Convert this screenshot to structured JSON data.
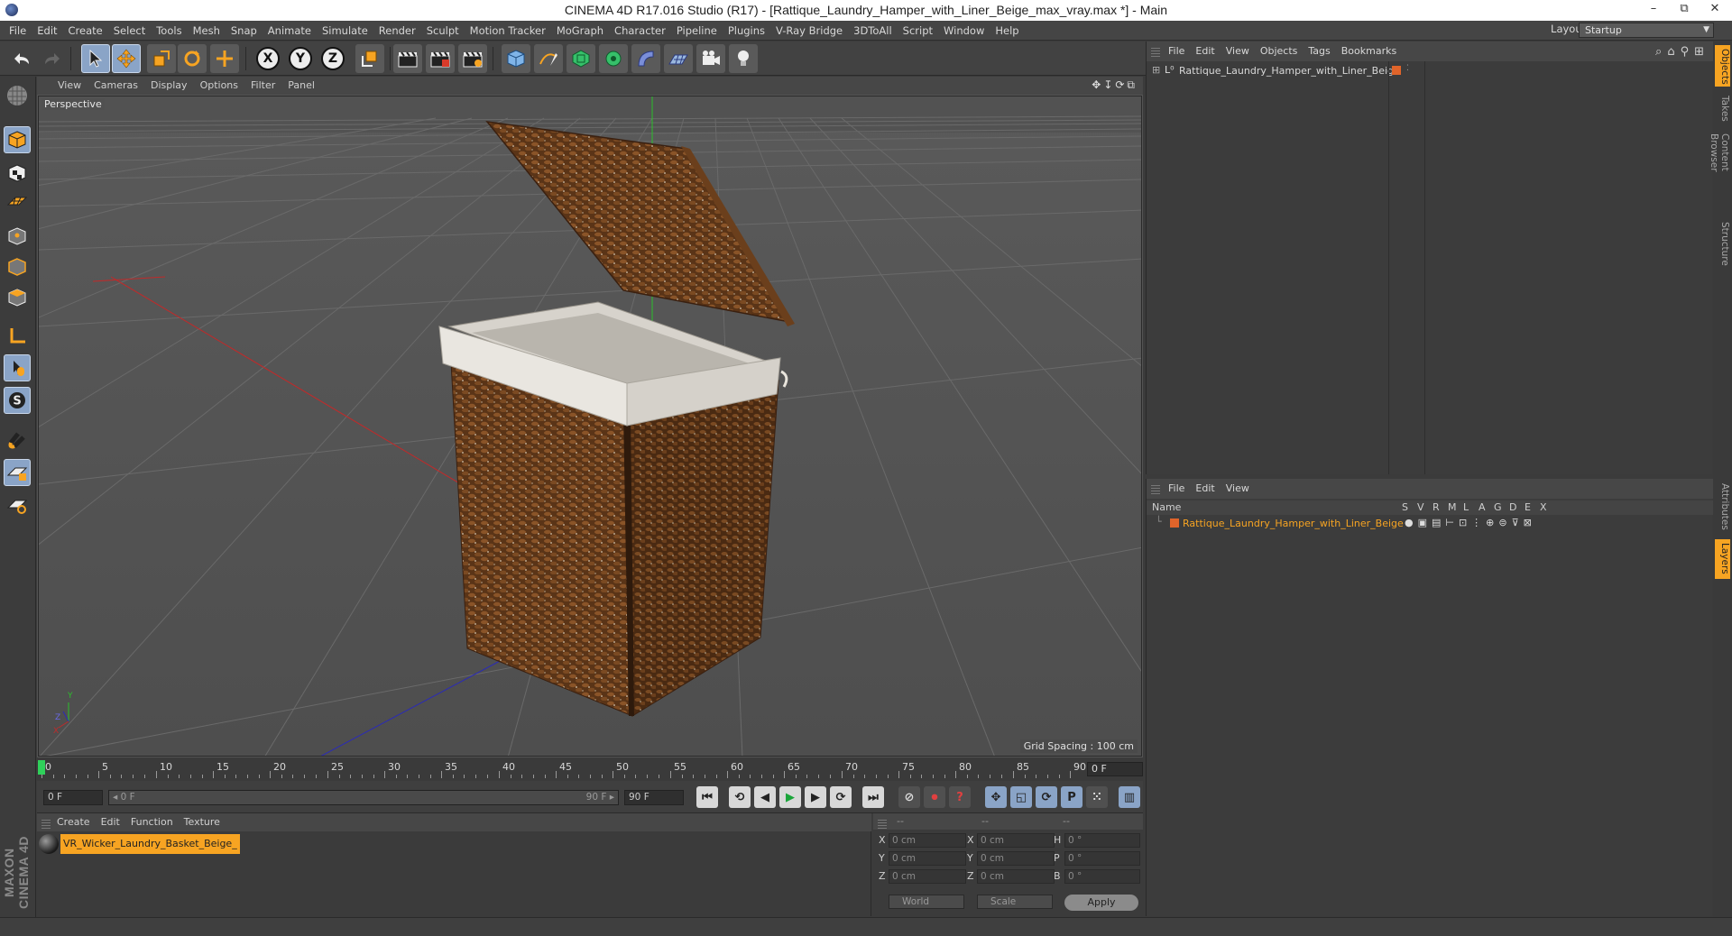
{
  "window": {
    "title": "CINEMA 4D R17.016 Studio (R17) - [Rattique_Laundry_Hamper_with_Liner_Beige_max_vray.max *] - Main",
    "minimize": "–",
    "maximize": "⧉",
    "close": "✕"
  },
  "menubar": {
    "items": [
      "File",
      "Edit",
      "Create",
      "Select",
      "Tools",
      "Mesh",
      "Snap",
      "Animate",
      "Simulate",
      "Render",
      "Sculpt",
      "Motion Tracker",
      "MoGraph",
      "Character",
      "Pipeline",
      "Plugins",
      "V-Ray Bridge",
      "3DToAll",
      "Script",
      "Window",
      "Help"
    ],
    "layout_label": "Layout:",
    "layout_value": "Startup"
  },
  "toolbar": {
    "axis_x": "X",
    "axis_y": "Y",
    "axis_z": "Z"
  },
  "viewport": {
    "menu": [
      "View",
      "Cameras",
      "Display",
      "Options",
      "Filter",
      "Panel"
    ],
    "label": "Perspective",
    "grid_spacing": "Grid Spacing : 100 cm",
    "nav_icons": "✥↧⟳⧉",
    "axis_y": "Y",
    "axis_x": "X",
    "axis_z": "Z"
  },
  "timeline": {
    "ticks": [
      "0",
      "5",
      "10",
      "15",
      "20",
      "25",
      "30",
      "35",
      "40",
      "45",
      "50",
      "55",
      "60",
      "65",
      "70",
      "75",
      "80",
      "85",
      "90"
    ],
    "current_frame": "0 F"
  },
  "transport": {
    "start_field": "0 F",
    "range_start": "◂ 0 F",
    "range_end": "90 F ▸",
    "end_field": "90 F"
  },
  "materials": {
    "menu": [
      "Create",
      "Edit",
      "Function",
      "Texture"
    ],
    "items": [
      {
        "name": "VR_Wicker_Laundry_Basket_Beige_"
      }
    ]
  },
  "coords": {
    "header": [
      "--",
      "--",
      "--"
    ],
    "rows": [
      {
        "a": "X",
        "av": "0 cm",
        "b": "X",
        "bv": "0 cm",
        "c": "H",
        "cv": "0 °"
      },
      {
        "a": "Y",
        "av": "0 cm",
        "b": "Y",
        "bv": "0 cm",
        "c": "P",
        "cv": "0 °"
      },
      {
        "a": "Z",
        "av": "0 cm",
        "b": "Z",
        "bv": "0 cm",
        "c": "B",
        "cv": "0 °"
      }
    ],
    "world": "World",
    "scale": "Scale",
    "apply": "Apply"
  },
  "object_manager": {
    "menu": [
      "File",
      "Edit",
      "View",
      "Objects",
      "Tags",
      "Bookmarks"
    ],
    "icons": "⌕⌂⚲⊞",
    "objects": [
      {
        "name": "Rattique_Laundry_Hamper_with_Liner_Beige",
        "layer_color": "#e0642a"
      }
    ]
  },
  "layer_manager": {
    "menu": [
      "File",
      "Edit",
      "View"
    ],
    "columns": {
      "name": "Name",
      "flags": [
        "S",
        "V",
        "R",
        "M",
        "L",
        "A",
        "G",
        "D",
        "E",
        "X"
      ]
    },
    "layers": [
      {
        "name": "Rattique_Laundry_Hamper_with_Liner_Beige",
        "color": "#e0642a"
      }
    ]
  },
  "side_tabs": {
    "top": [
      "Objects",
      "Takes",
      "Content Browser",
      "Structure"
    ],
    "bottom": [
      "Attributes",
      "Layers"
    ]
  },
  "branding": {
    "maxon": "MAXON CINEMA 4D"
  },
  "colors": {
    "accent": "#f7a422",
    "active_tool": "#8aa4c7",
    "playhead": "#2fd05a"
  }
}
